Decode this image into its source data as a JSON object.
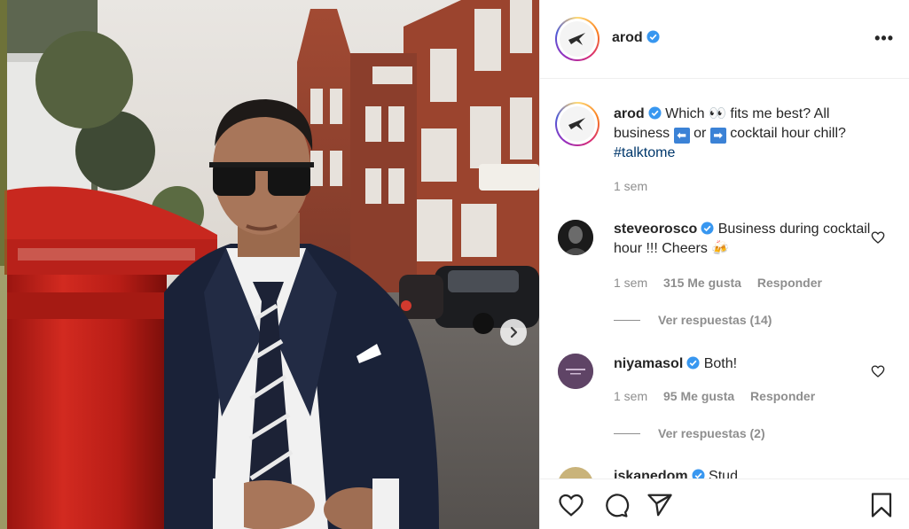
{
  "post": {
    "author": "arod",
    "caption_part1": "Which",
    "caption_emoji_eyes": "👀",
    "caption_part2": "fits me best? All business",
    "caption_arrow_left": "⬅",
    "caption_or": "or",
    "caption_arrow_right": "➡",
    "caption_part3": "cocktail hour chill?",
    "hashtag": "#talktome",
    "time": "1 sem"
  },
  "comments": [
    {
      "user": "steveorosco",
      "text": "Business during cocktail hour !!! Cheers",
      "emoji": "🍻",
      "time": "1 sem",
      "likes": "315 Me gusta",
      "reply": "Responder",
      "view_replies": "Ver respuestas (14)"
    },
    {
      "user": "niyamasol",
      "text": "Both!",
      "time": "1 sem",
      "likes": "95 Me gusta",
      "reply": "Responder",
      "view_replies": "Ver respuestas (2)"
    },
    {
      "user": "jskanedom",
      "text": "Stud"
    }
  ],
  "icons": {
    "more": "more-horizontal-icon",
    "like": "heart-icon",
    "comment": "comment-icon",
    "share": "send-icon",
    "save": "bookmark-icon",
    "verified": "verified-badge-icon",
    "next": "chevron-right-icon"
  },
  "colors": {
    "verified": "#3897f0",
    "text": "#262626",
    "secondary": "#8e8e8e",
    "hashtag": "#00376b"
  }
}
